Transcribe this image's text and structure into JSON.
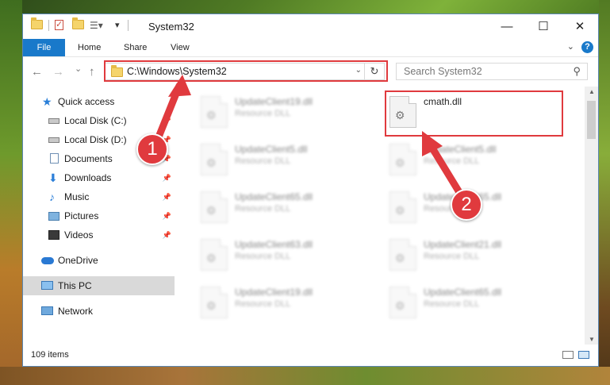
{
  "window": {
    "title": "System32",
    "minimize": "—",
    "maximize": "☐",
    "close": "✕"
  },
  "ribbon": {
    "file": "File",
    "home": "Home",
    "share": "Share",
    "view": "View"
  },
  "nav": {
    "back": "←",
    "forward": "→",
    "recent": "⌄",
    "up": "↑",
    "address": "C:\\Windows\\System32",
    "search_placeholder": "Search System32"
  },
  "sidebar": {
    "items": [
      {
        "label": "Quick access",
        "icon": "star-icon"
      },
      {
        "label": "Local Disk (C:)",
        "icon": "disk-icon",
        "pinned": true
      },
      {
        "label": "Local Disk (D:)",
        "icon": "disk-icon",
        "pinned": true
      },
      {
        "label": "Documents",
        "icon": "documents-icon",
        "pinned": true
      },
      {
        "label": "Downloads",
        "icon": "downloads-icon",
        "pinned": true
      },
      {
        "label": "Music",
        "icon": "music-icon",
        "pinned": true
      },
      {
        "label": "Pictures",
        "icon": "pictures-icon",
        "pinned": true
      },
      {
        "label": "Videos",
        "icon": "videos-icon",
        "pinned": true
      },
      {
        "label": "OneDrive",
        "icon": "onedrive-icon"
      },
      {
        "label": "This PC",
        "icon": "this-pc-icon",
        "selected": true
      },
      {
        "label": "Network",
        "icon": "network-icon"
      }
    ]
  },
  "files": [
    {
      "name": "UpdateClient19.dll",
      "desc": "Resource DLL"
    },
    {
      "name": "cmath.dll",
      "desc": ""
    },
    {
      "name": "UpdateClient5.dll",
      "desc": "Resource DLL"
    },
    {
      "name": "UpdateClient5.dll",
      "desc": "Resource DLL"
    },
    {
      "name": "UpdateClient65.dll",
      "desc": "Resource DLL"
    },
    {
      "name": "UpdateClient65.dll",
      "desc": "Resource DLL"
    },
    {
      "name": "UpdateClient63.dll",
      "desc": "Resource DLL"
    },
    {
      "name": "UpdateClient21.dll",
      "desc": "Resource DLL"
    },
    {
      "name": "UpdateClient19.dll",
      "desc": "Resource DLL"
    },
    {
      "name": "UpdateClient65.dll",
      "desc": "Resource DLL"
    }
  ],
  "status": {
    "count": "109 items"
  },
  "callouts": {
    "step1": "1",
    "step2": "2"
  },
  "colors": {
    "accent": "#1979ca",
    "highlight": "#e03a3e"
  }
}
